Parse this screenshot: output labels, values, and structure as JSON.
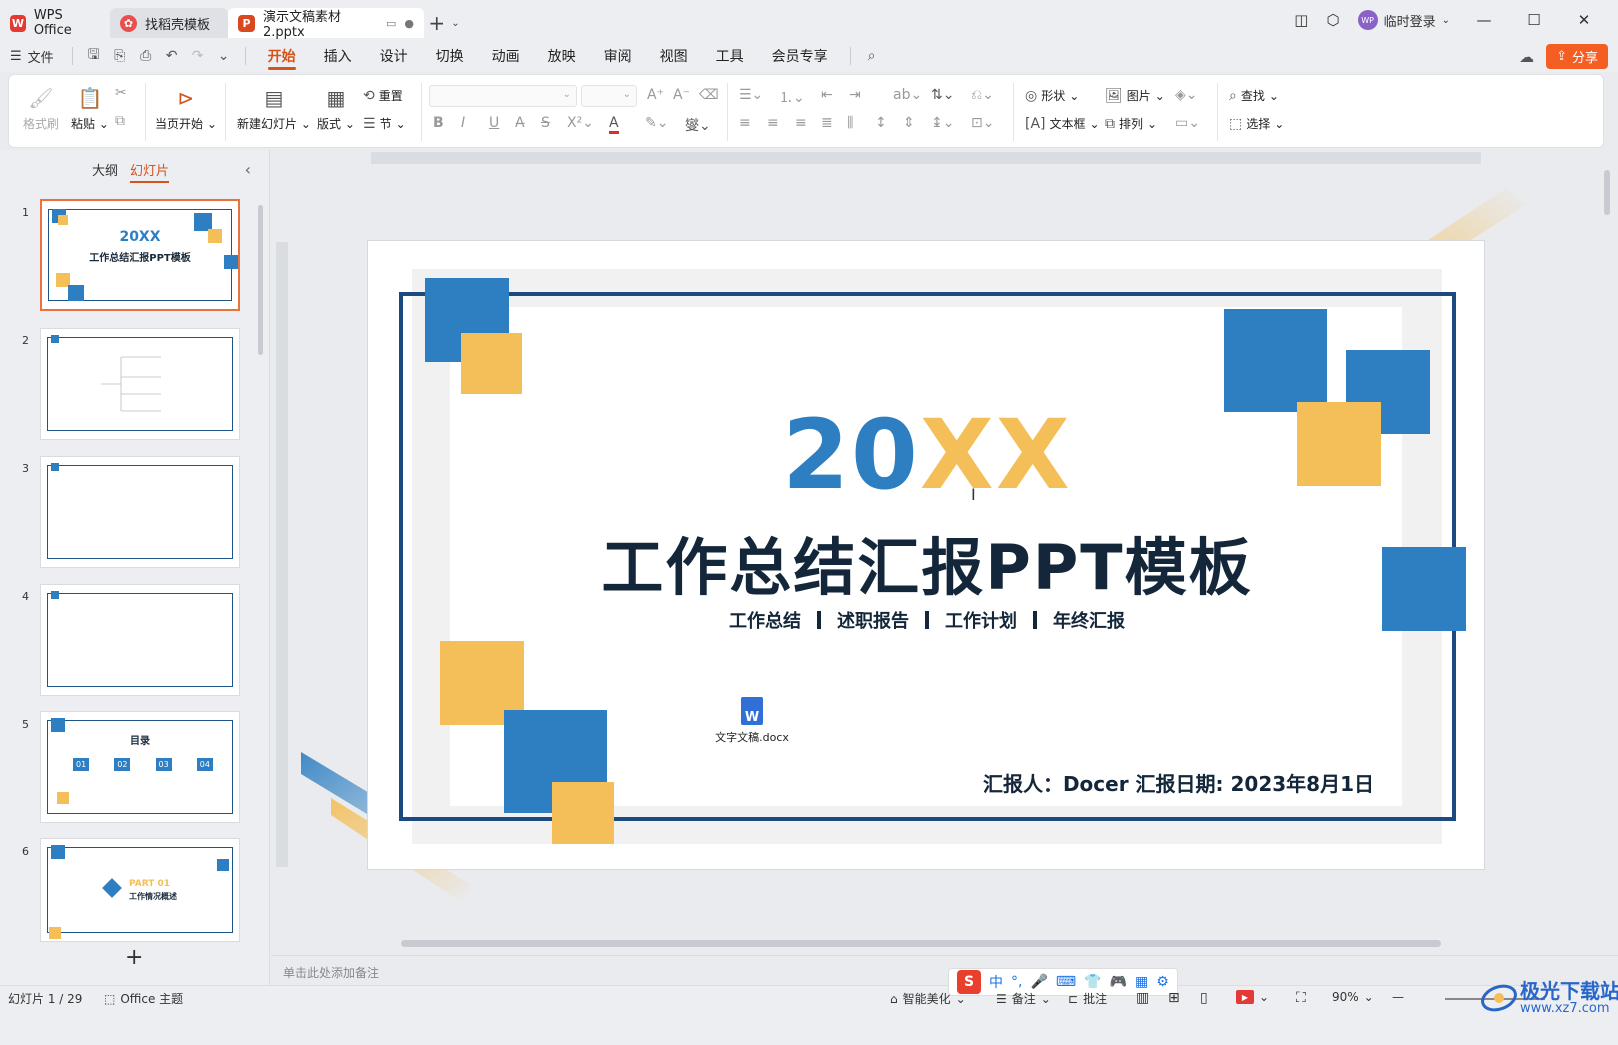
{
  "titlebar": {
    "home_tab": "WPS Office",
    "store_tab": "找稻壳模板",
    "doc_tab": "演示文稿素材2.pptx",
    "login": "临时登录",
    "avatar_text": "WP"
  },
  "menubar": {
    "file": "文件",
    "items": [
      "开始",
      "插入",
      "设计",
      "切换",
      "动画",
      "放映",
      "审阅",
      "视图",
      "工具",
      "会员专享"
    ],
    "active": "开始",
    "share": "分享"
  },
  "ribbon": {
    "format_painter": "格式刷",
    "paste": "粘贴",
    "play_from_current": "当页开始",
    "new_slide": "新建幻灯片",
    "layout": "版式",
    "reset": "重置",
    "section": "节",
    "shapes": "形状",
    "picture": "图片",
    "textbox": "文本框",
    "arrange": "排列",
    "find": "查找",
    "select": "选择"
  },
  "panel": {
    "tab_outline": "大纲",
    "tab_slides": "幻灯片",
    "slides": [
      {
        "num": "1",
        "title": "20XX",
        "subtitle": "工作总结汇报PPT模板"
      },
      {
        "num": "2"
      },
      {
        "num": "3"
      },
      {
        "num": "4"
      },
      {
        "num": "5",
        "title": "目录",
        "items": [
          "01",
          "02",
          "03",
          "04"
        ]
      },
      {
        "num": "6",
        "title": "PART 01",
        "subtitle": "工作情况概述"
      }
    ]
  },
  "slide": {
    "year_blue": "20",
    "year_gold": "XX",
    "title": "工作总结汇报PPT模板",
    "sub_items": [
      "工作总结",
      "述职报告",
      "工作计划",
      "年终汇报"
    ],
    "reporter": "汇报人：Docer  汇报日期: 2023年8月1日",
    "attachment": "文字文稿.docx",
    "attachment_icon": "W"
  },
  "notes_placeholder": "单击此处添加备注",
  "status": {
    "slide_count": "幻灯片 1 / 29",
    "theme": "Office 主题",
    "beautify": "智能美化",
    "notes": "备注",
    "comments": "批注",
    "zoom": "90%",
    "ime_lang": "中"
  },
  "watermark": {
    "line1": "极光下载站",
    "line2": "www.xz7.com"
  },
  "colors": {
    "accent": "#d4531c",
    "blue": "#2e7fc1",
    "gold": "#f4bf58",
    "navy": "#1c4a7e"
  }
}
